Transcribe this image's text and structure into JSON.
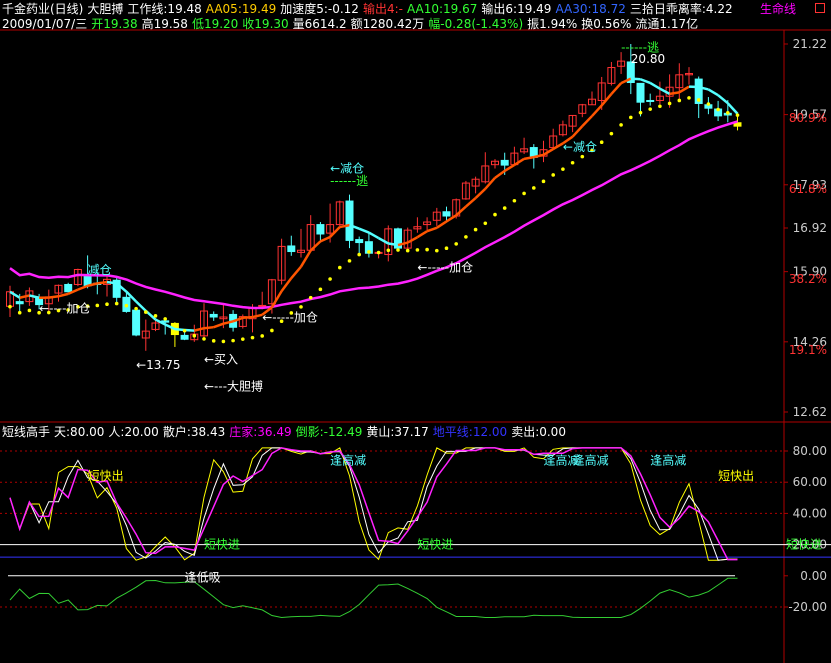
{
  "header": {
    "line1": [
      {
        "text": "千金药业(日线)",
        "color": "#ffffff"
      },
      {
        "text": "大胆搏",
        "color": "#ffffff"
      },
      {
        "text": "工作线:19.48",
        "color": "#ffffff"
      },
      {
        "text": "AA05:19.49",
        "color": "#ffcc00"
      },
      {
        "text": "加速度5:-0.12",
        "color": "#ffffff"
      },
      {
        "text": "输出4:-",
        "color": "#ff3333"
      },
      {
        "text": "AA10:19.67",
        "color": "#33ff33"
      },
      {
        "text": "输出6:19.49",
        "color": "#ffffff"
      },
      {
        "text": "AA30:18.72",
        "color": "#3366ff"
      },
      {
        "text": "三拾日乖离率:4.22",
        "color": "#ffffff"
      }
    ],
    "line2": [
      {
        "text": "2009/01/07/三",
        "color": "#ffffff"
      },
      {
        "text": "开19.38",
        "color": "#33ff33"
      },
      {
        "text": "高19.58",
        "color": "#ffffff"
      },
      {
        "text": "低19.20",
        "color": "#33ff33"
      },
      {
        "text": "收19.30",
        "color": "#33ff33"
      },
      {
        "text": "量6614.2",
        "color": "#ffffff"
      },
      {
        "text": "额1280.42万",
        "color": "#ffffff"
      },
      {
        "text": "幅-0.28(-1.43%)",
        "color": "#33ff33"
      },
      {
        "text": "振1.94%",
        "color": "#ffffff"
      },
      {
        "text": "换0.56%",
        "color": "#ffffff"
      },
      {
        "text": "流通1.17亿",
        "color": "#ffffff"
      }
    ],
    "life_line": "生命线",
    "life_line_color": "#ff00ff"
  },
  "sub_header": [
    {
      "text": "短线高手",
      "color": "#ffffff"
    },
    {
      "text": "天:80.00",
      "color": "#ffffff"
    },
    {
      "text": "人:20.00",
      "color": "#ffffff"
    },
    {
      "text": "散户:38.43",
      "color": "#ffffff"
    },
    {
      "text": "庄家:36.49",
      "color": "#ff00ff"
    },
    {
      "text": "倒影:-12.49",
      "color": "#33ff33"
    },
    {
      "text": "黄山:37.17",
      "color": "#ffffff"
    },
    {
      "text": "地平线:12.00",
      "color": "#3333ff"
    },
    {
      "text": "卖出:0.00",
      "color": "#ffffff"
    }
  ],
  "colors": {
    "up": "#ff3333",
    "down": "#54ffff",
    "axis": "#b00000",
    "yellow": "#ffff00",
    "magenta": "#ff22ff",
    "green": "#33cc33",
    "orange": "#ff5500"
  },
  "chart_data": {
    "type": "candlestick",
    "upper_yticks": [
      "21.22",
      "19.57",
      "17.93",
      "16.92",
      "15.90",
      "14.26",
      "12.62"
    ],
    "upper_percent_ticks": [
      "80.9%",
      "61.8%",
      "38.2%",
      "19.1%"
    ],
    "candles": [
      [
        15.09,
        15.43,
        15.57,
        14.84
      ],
      [
        15.2,
        15.15,
        15.38,
        14.9
      ],
      [
        15.2,
        15.45,
        15.53,
        15.1
      ],
      [
        15.3,
        15.13,
        15.38,
        15.02
      ],
      [
        15.15,
        15.31,
        15.48,
        14.93
      ],
      [
        15.4,
        15.58,
        15.6,
        15.2
      ],
      [
        15.6,
        15.43,
        15.64,
        15.42
      ],
      [
        15.6,
        15.95,
        15.97,
        15.56
      ],
      [
        15.8,
        15.57,
        16.28,
        15.51
      ],
      [
        15.63,
        15.6,
        15.89,
        15.37
      ],
      [
        15.6,
        15.72,
        15.83,
        15.32
      ],
      [
        15.7,
        15.3,
        15.75,
        15.15
      ],
      [
        15.3,
        14.97,
        15.44,
        14.94
      ],
      [
        15.0,
        14.42,
        15.05,
        14.39
      ],
      [
        14.35,
        14.51,
        14.78,
        14.05
      ],
      [
        14.55,
        14.7,
        14.77,
        14.51
      ],
      [
        14.75,
        14.72,
        14.76,
        14.43
      ],
      [
        14.69,
        14.43,
        14.72,
        14.14
      ],
      [
        14.41,
        14.32,
        14.52,
        14.3
      ],
      [
        14.31,
        14.44,
        14.66,
        14.26
      ],
      [
        14.4,
        14.98,
        15.16,
        14.34
      ],
      [
        14.9,
        14.84,
        14.97,
        14.75
      ],
      [
        14.8,
        14.84,
        15.14,
        14.58
      ],
      [
        14.9,
        14.6,
        15.0,
        14.5
      ],
      [
        14.62,
        14.85,
        14.9,
        14.57
      ],
      [
        14.8,
        15.06,
        15.14,
        14.48
      ],
      [
        15.1,
        15.11,
        15.43,
        15.02
      ],
      [
        15.15,
        15.71,
        15.73,
        14.92
      ],
      [
        15.7,
        16.49,
        16.67,
        15.6
      ],
      [
        16.5,
        16.37,
        16.74,
        16.27
      ],
      [
        16.35,
        16.4,
        16.9,
        16.23
      ],
      [
        16.4,
        17.0,
        17.22,
        16.37
      ],
      [
        17.0,
        16.78,
        17.06,
        16.58
      ],
      [
        16.8,
        17.0,
        17.49,
        16.58
      ],
      [
        17.0,
        17.53,
        17.56,
        16.93
      ],
      [
        17.55,
        16.63,
        17.7,
        16.45
      ],
      [
        16.65,
        16.58,
        16.72,
        16.32
      ],
      [
        16.6,
        16.33,
        16.83,
        16.23
      ],
      [
        16.35,
        16.35,
        16.37,
        16.21
      ],
      [
        16.3,
        16.9,
        16.98,
        16.14
      ],
      [
        16.9,
        16.45,
        16.93,
        16.4
      ],
      [
        16.45,
        16.87,
        16.93,
        16.38
      ],
      [
        16.9,
        16.95,
        17.17,
        16.81
      ],
      [
        17.0,
        17.06,
        17.17,
        16.87
      ],
      [
        17.1,
        17.29,
        17.39,
        16.97
      ],
      [
        17.3,
        17.2,
        17.42,
        17.07
      ],
      [
        17.2,
        17.58,
        17.61,
        17.14
      ],
      [
        17.6,
        17.97,
        18.02,
        17.58
      ],
      [
        17.9,
        18.06,
        18.12,
        17.73
      ],
      [
        18.0,
        18.37,
        18.69,
        17.96
      ],
      [
        18.4,
        18.48,
        18.53,
        18.31
      ],
      [
        18.5,
        18.39,
        18.68,
        18.16
      ],
      [
        18.4,
        18.67,
        18.82,
        18.39
      ],
      [
        18.7,
        18.77,
        19.03,
        18.65
      ],
      [
        18.8,
        18.57,
        18.88,
        18.31
      ],
      [
        18.6,
        18.75,
        18.96,
        18.46
      ],
      [
        18.8,
        19.07,
        19.24,
        18.76
      ],
      [
        19.1,
        19.33,
        19.43,
        19.06
      ],
      [
        19.3,
        19.55,
        19.56,
        19.16
      ],
      [
        19.6,
        19.8,
        19.82,
        19.51
      ],
      [
        19.8,
        19.93,
        20.11,
        19.8
      ],
      [
        19.9,
        20.31,
        20.45,
        19.68
      ],
      [
        20.3,
        20.67,
        20.8,
        20.25
      ],
      [
        20.7,
        20.82,
        21.03,
        20.52
      ],
      [
        20.8,
        20.32,
        21.22,
        20.05
      ],
      [
        20.3,
        19.86,
        20.3,
        19.53
      ],
      [
        19.9,
        19.88,
        20.06,
        19.78
      ],
      [
        19.9,
        20.0,
        20.34,
        19.81
      ],
      [
        20.0,
        20.21,
        20.51,
        19.73
      ],
      [
        20.2,
        20.5,
        20.77,
        19.93
      ],
      [
        20.5,
        20.53,
        20.68,
        20.27
      ],
      [
        20.4,
        19.83,
        20.46,
        19.49
      ],
      [
        19.8,
        19.72,
        19.98,
        19.58
      ],
      [
        19.7,
        19.54,
        19.89,
        19.42
      ],
      [
        19.6,
        19.56,
        19.91,
        19.39
      ],
      [
        19.38,
        19.3,
        19.58,
        19.2
      ]
    ],
    "upper_annotations": [
      {
        "text": "减仓",
        "candle": 8,
        "price": 15.85,
        "color": "#54ffff"
      },
      {
        "text": "←----加仓",
        "candle": 3,
        "price": 14.94,
        "color": "#ffffff"
      },
      {
        "text": "←13.75",
        "candle": 13,
        "price": 13.62,
        "color": "#ffffff"
      },
      {
        "text": "←买入",
        "candle": 20,
        "price": 13.75,
        "color": "#ffffff"
      },
      {
        "text": "←---大胆搏",
        "candle": 20,
        "price": 13.12,
        "color": "#ffffff"
      },
      {
        "text": "←-----加仓",
        "candle": 26,
        "price": 14.74,
        "color": "#ffffff"
      },
      {
        "text": "←减仓",
        "candle": 33,
        "price": 18.22,
        "color": "#54ffff"
      },
      {
        "text": "------逃",
        "candle": 33,
        "price": 17.93,
        "color": "#33ff33"
      },
      {
        "text": "←-----加仓",
        "candle": 42,
        "price": 15.9,
        "color": "#ffffff"
      },
      {
        "text": "←减仓",
        "candle": 57,
        "price": 18.72,
        "color": "#54ffff"
      },
      {
        "text": "------逃",
        "candle": 63,
        "price": 21.05,
        "color": "#33ff33"
      },
      {
        "text": "20.80",
        "candle": 64,
        "price": 20.78,
        "color": "#ffffff"
      }
    ],
    "lower_yticks": [
      "80.00",
      "60.00",
      "40.00",
      "20.00",
      "0.00",
      "-20.00"
    ],
    "lower_annotations": [
      {
        "text": "短快出",
        "candle": 8,
        "value": 64,
        "color": "#ffff00"
      },
      {
        "text": "短快进",
        "candle": 20,
        "value": 20,
        "color": "#33ff33"
      },
      {
        "text": "短快进",
        "candle": 42,
        "value": 20,
        "color": "#33ff33"
      },
      {
        "text": "短快进",
        "candle": 80,
        "value": 20,
        "color": "#33ff33"
      },
      {
        "text": "逢高减",
        "candle": 33,
        "value": 74,
        "color": "#54ffff"
      },
      {
        "text": "逢高减",
        "candle": 55,
        "value": 74,
        "color": "#54ffff"
      },
      {
        "text": "逢高减",
        "candle": 58,
        "value": 74,
        "color": "#54ffff"
      },
      {
        "text": "逢高减",
        "candle": 66,
        "value": 74,
        "color": "#54ffff"
      },
      {
        "text": "短快出",
        "candle": 73,
        "value": 64,
        "color": "#ffff00"
      },
      {
        "text": "逢低吸",
        "candle": 18,
        "value": -1,
        "color": "#ffffff"
      }
    ]
  }
}
